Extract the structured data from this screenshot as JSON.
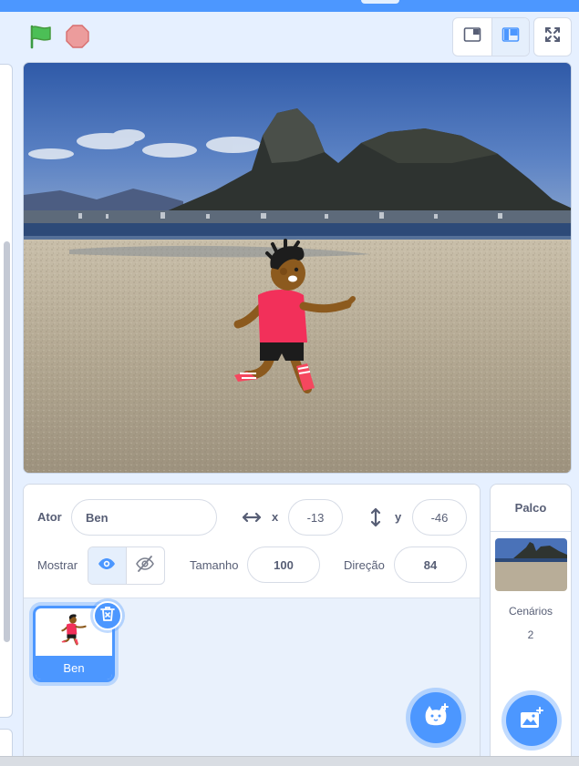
{
  "colors": {
    "accent": "#4c97ff",
    "flag_green": "#4cbf56",
    "stop_red": "#ec9c9c",
    "text": "#575e75"
  },
  "toolbar": {
    "green_flag": "green-flag-icon",
    "stop": "stop-icon",
    "small_stage_mode": "small-stage-icon",
    "normal_stage_mode": "normal-stage-icon",
    "fullscreen": "fullscreen-icon"
  },
  "sprite_info": {
    "sprite_label": "Ator",
    "sprite_name": "Ben",
    "x_label": "x",
    "x_value": "-13",
    "y_label": "y",
    "y_value": "-46",
    "show_label": "Mostrar",
    "size_label": "Tamanho",
    "size_value": "100",
    "direction_label": "Direção",
    "direction_value": "84",
    "visible": true
  },
  "sprites": [
    {
      "name": "Ben",
      "selected": true
    }
  ],
  "stage_panel": {
    "title": "Palco",
    "backdrops_label": "Cenários",
    "backdrops_count": "2"
  }
}
